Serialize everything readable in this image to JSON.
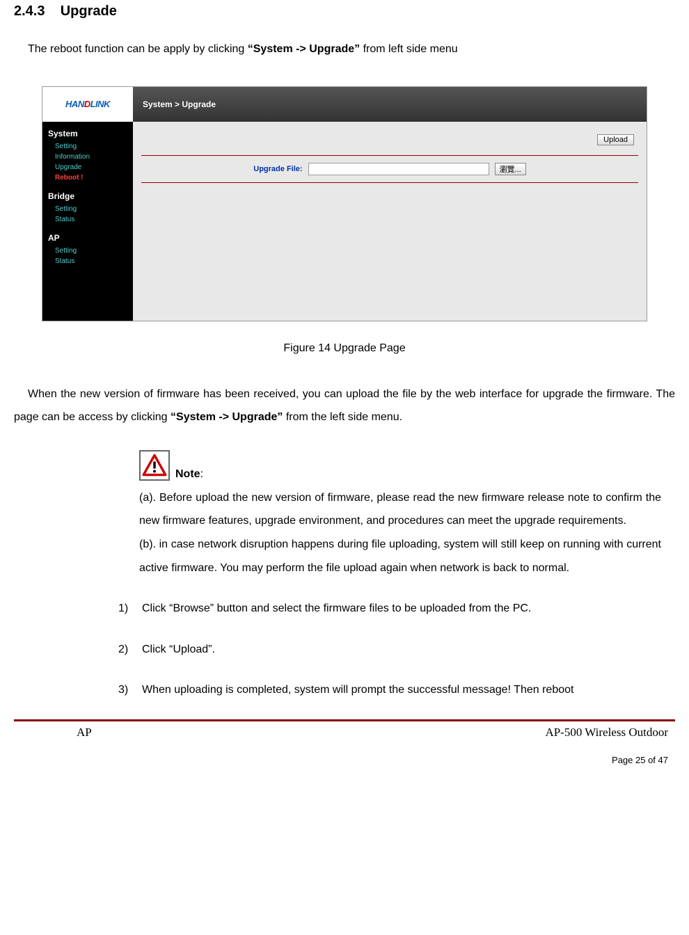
{
  "heading": {
    "number": "2.4.3",
    "title": "Upgrade"
  },
  "intro": {
    "pre": "The reboot function can be apply by clicking ",
    "bold": "“System -> Upgrade”",
    "post": " from left side menu"
  },
  "screenshot": {
    "logo": {
      "han": "HAN",
      "d": "D",
      "link": "LINK"
    },
    "breadcrumb": "System > Upgrade",
    "nav": {
      "g1": "System",
      "g1_items": [
        "Setting",
        "Information",
        "Upgrade",
        "Reboot !"
      ],
      "g2": "Bridge",
      "g2_items": [
        "Setting",
        "Status"
      ],
      "g3": "AP",
      "g3_items": [
        "Setting",
        "Status"
      ]
    },
    "upload_button": "Upload",
    "form_label": "Upgrade File:",
    "browse_button": "瀏覽..."
  },
  "figure_caption": "Figure 14    Upgrade Page",
  "para2": {
    "pre": "When the new version of firmware has been received, you can upload the file by the web interface for upgrade the firmware. The page can be access by clicking ",
    "bold": "“System -> Upgrade”",
    "post": " from the left side menu."
  },
  "note": {
    "label": "Note",
    "colon": ":",
    "a": "(a). Before upload the new version of firmware, please read the new firmware release note to confirm the new firmware features, upgrade environment, and procedures can meet the upgrade requirements.",
    "b": "(b). in case network disruption happens during file uploading, system will still keep on running with current active firmware. You may perform the file upload again when network is back to normal."
  },
  "steps": [
    {
      "num": "1)",
      "text": "Click “Browse” button and select the firmware files to be uploaded from the PC."
    },
    {
      "num": "2)",
      "text": "Click “Upload”."
    },
    {
      "num": "3)",
      "text": "When uploading is completed, system will prompt the successful message! Then reboot"
    }
  ],
  "footer": {
    "left": "AP",
    "right": "AP-500    Wireless  Outdoor",
    "page": "Page 25 of 47"
  }
}
